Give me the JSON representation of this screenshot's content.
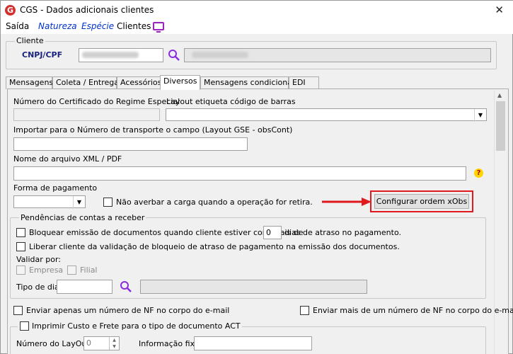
{
  "window": {
    "title": "CGS - Dados adicionais clientes",
    "logo_letter": "G",
    "close_glyph": "✕"
  },
  "menu": {
    "items": [
      "Saída",
      "Natureza",
      "Espécie",
      "Clientes"
    ]
  },
  "cliente": {
    "group_label": "Cliente",
    "cnpj_label": "CNPJ/CPF"
  },
  "tabs": [
    "Mensagens",
    "Coleta / Entrega",
    "Acessórios",
    "Diversos",
    "Mensagens condicionais",
    "EDI"
  ],
  "active_tab": "Diversos",
  "diversos": {
    "cert_label": "Número do Certificado do Regime Especial",
    "layout_label": "Layout etiqueta código de barras",
    "importar_label": "Importar para o Número de transporte o campo (Layout GSE - obsCont)",
    "xml_label": "Nome do arquivo XML / PDF",
    "help_glyph": "?",
    "forma_label": "Forma de pagamento",
    "nao_averbar_label": "Não averbar a carga quando a operação for retira.",
    "config_button_label": "Configurar ordem xObs",
    "pendencias_label": "Pendências de contas a receber",
    "bloquear_label_a": "Bloquear emissão de documentos quando cliente estiver com mais de",
    "bloquear_days_value": "0",
    "bloquear_label_b": "dias de atraso no pagamento.",
    "liberar_label": "Liberar cliente da validação de bloqueio de atraso de pagamento na emissão dos documentos.",
    "validar_label": "Validar por:",
    "empresa_label": "Empresa",
    "filial_label": "Filial",
    "tipo_dia_label": "Tipo de dia",
    "enviar_um_label": "Enviar apenas um número de NF no corpo do e-mail",
    "enviar_mais_label": "Enviar mais de um número de NF no corpo do e-mail",
    "imprimir_label": "Imprimir Custo e Frete para o tipo de documento ACT",
    "numero_layout_label": "Número do LayOut",
    "numero_layout_value": "0",
    "informacao_fixa_label": "Informação fixa"
  },
  "colors": {
    "accent_red": "#e0191e",
    "link_blue": "#0033cc",
    "monitor_purple": "#a020c0"
  }
}
